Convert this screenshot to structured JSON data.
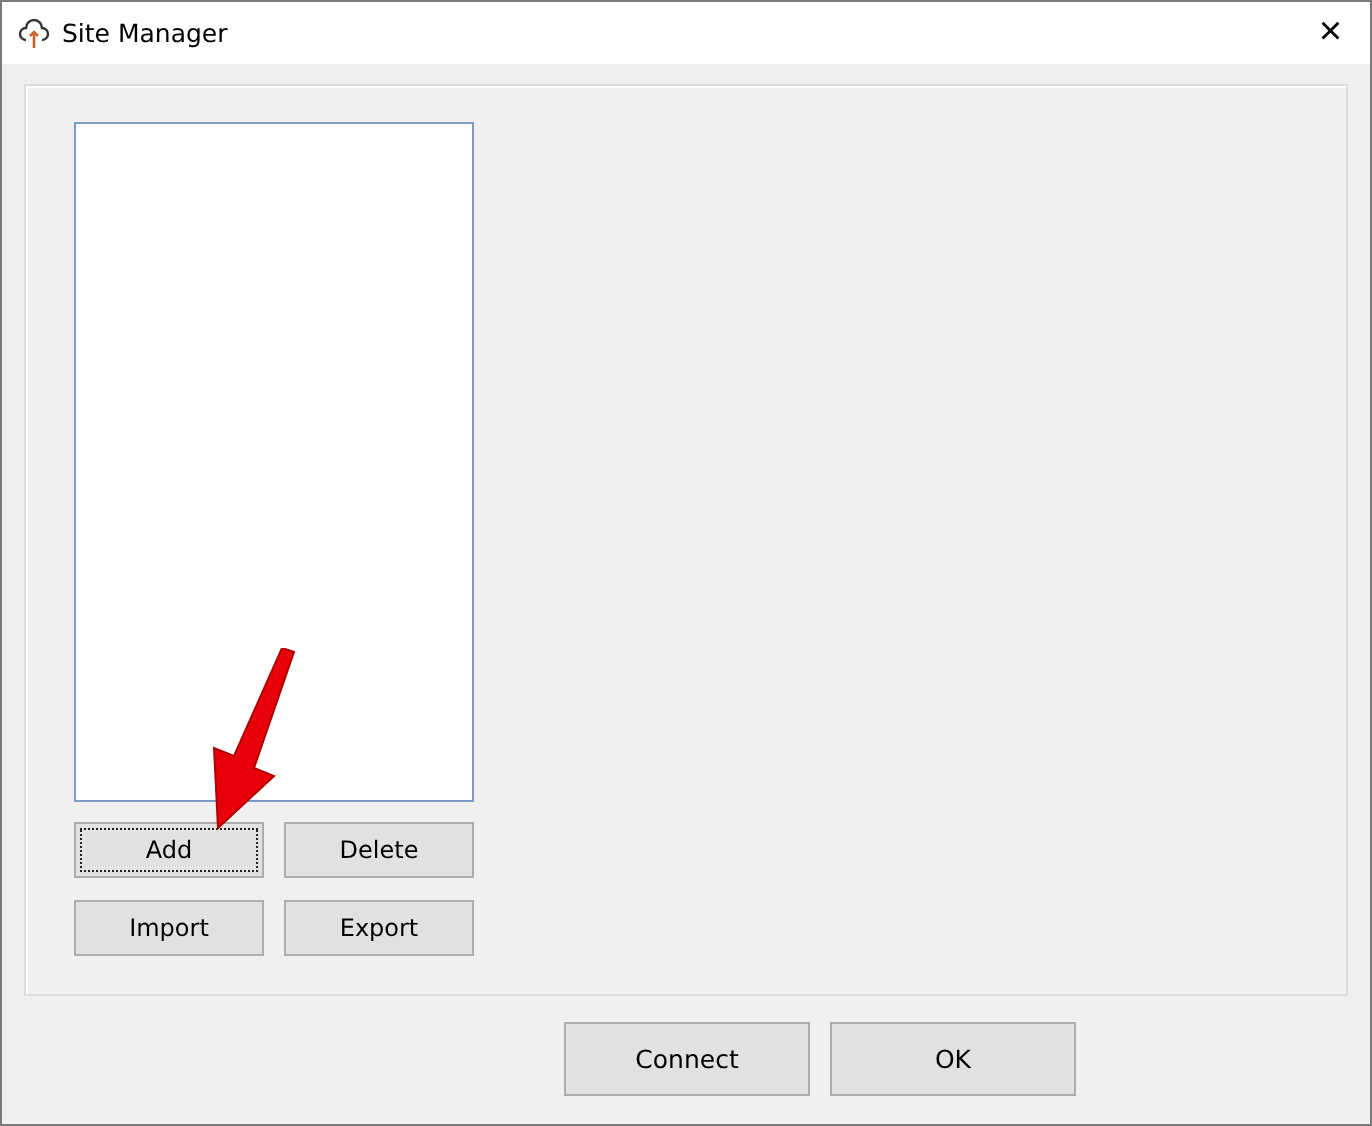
{
  "window": {
    "title": "Site Manager",
    "close": "×"
  },
  "site_buttons": [
    {
      "label": "Add",
      "focused": true
    },
    {
      "label": "Delete",
      "focused": false
    },
    {
      "label": "Import",
      "focused": false
    },
    {
      "label": "Export",
      "focused": false
    }
  ],
  "footer_buttons": [
    "Connect",
    "OK"
  ]
}
